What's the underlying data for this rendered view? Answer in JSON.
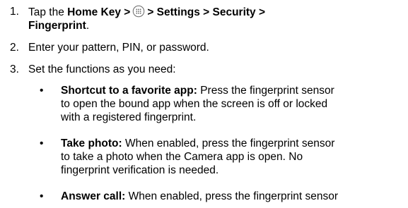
{
  "steps": [
    {
      "number": "1.",
      "text_before_icon": "Tap the ",
      "bold_a": "Home Key >",
      "icon_name": "apps-grid-icon",
      "bold_b": "> Settings > Security >",
      "bold_c": "Fingerprint",
      "trailing": "."
    },
    {
      "number": "2.",
      "text": "Enter your pattern, PIN, or password."
    },
    {
      "number": "3.",
      "text": "Set the functions as you need:"
    }
  ],
  "bullets": [
    {
      "symbol": "•",
      "title": "Shortcut to a favorite app:",
      "line1": "Press the fingerprint sensor",
      "line2": "to open the bound app when the screen is off or locked",
      "line3": "with a registered fingerprint."
    },
    {
      "symbol": "•",
      "title": "Take photo:",
      "line1": "When enabled, press the fingerprint sensor",
      "line2": "to take a photo when the Camera app is open. No",
      "line3": "fingerprint verification is needed."
    },
    {
      "symbol": "•",
      "title": "Answer call:",
      "line1": "When enabled, press the fingerprint sensor"
    }
  ]
}
